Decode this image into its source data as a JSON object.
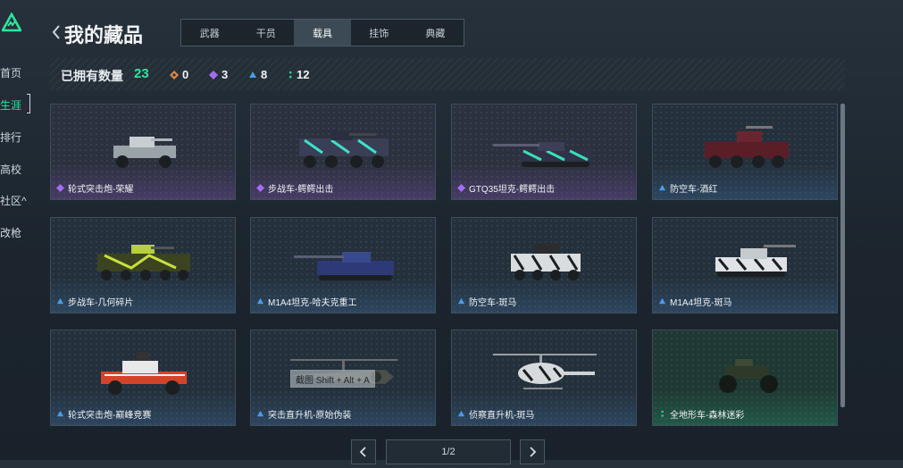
{
  "sidebar": {
    "items": [
      {
        "label": "首页"
      },
      {
        "label": "生涯"
      },
      {
        "label": "排行"
      },
      {
        "label": "高校"
      },
      {
        "label": "社区^"
      },
      {
        "label": "改枪"
      }
    ]
  },
  "header": {
    "title": "我的藏品"
  },
  "tabs": [
    {
      "label": "武器"
    },
    {
      "label": "干员"
    },
    {
      "label": "载具"
    },
    {
      "label": "挂饰"
    },
    {
      "label": "典藏"
    }
  ],
  "stats": {
    "owned_label": "已拥有数量",
    "owned_count": "23",
    "orange": "0",
    "purple": "3",
    "blue": "8",
    "green": "12"
  },
  "colors": {
    "accent": "#2ee6a0",
    "rarity_orange": "#d98a4a",
    "rarity_purple": "#a56cf0",
    "rarity_blue": "#4c9be8",
    "rarity_green": "#2ed58d"
  },
  "cards": [
    {
      "name": "轮式突击炮-荣耀",
      "rarity": "purple"
    },
    {
      "name": "步战车-鳄鳄出击",
      "rarity": "purple"
    },
    {
      "name": "GTQ35坦克-鳄鳄出击",
      "rarity": "purple"
    },
    {
      "name": "防空车-酒红",
      "rarity": "blue"
    },
    {
      "name": "步战车-几何碎片",
      "rarity": "blue"
    },
    {
      "name": "M1A4坦克-哈夫克重工",
      "rarity": "blue"
    },
    {
      "name": "防空车-斑马",
      "rarity": "blue"
    },
    {
      "name": "M1A4坦克-斑马",
      "rarity": "blue"
    },
    {
      "name": "轮式突击炮-巅峰竞赛",
      "rarity": "blue"
    },
    {
      "name": "突击直升机-原始伪装",
      "rarity": "blue"
    },
    {
      "name": "侦察直升机-斑马",
      "rarity": "blue"
    },
    {
      "name": "全地形车-森林迷彩",
      "rarity": "green"
    }
  ],
  "pagination": {
    "indicator": "1/2"
  },
  "tooltip": {
    "text": "截图 Shift + Alt + A"
  }
}
